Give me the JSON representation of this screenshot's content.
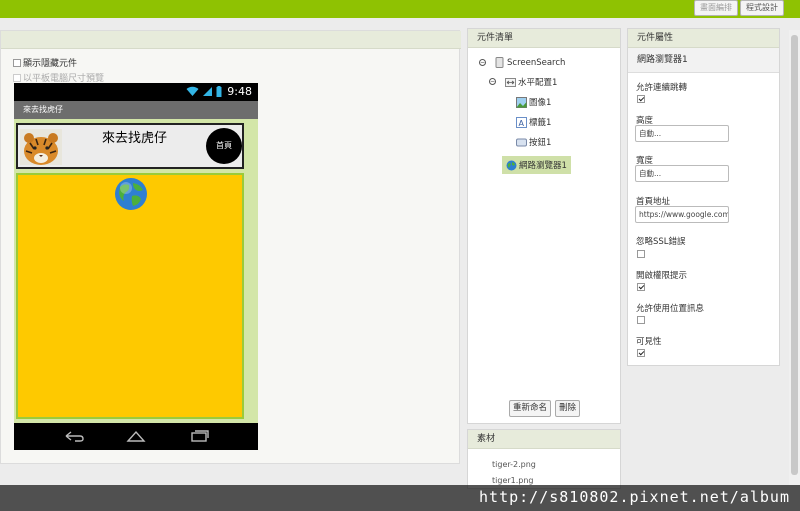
{
  "toolbar": {
    "designer_label": "畫面編排",
    "blocks_label": "程式設計"
  },
  "viewer": {
    "show_hidden_label": "顯示隱藏元件",
    "tablet_preview_label": "以平板電腦尺寸預覽",
    "phone": {
      "time": "9:48",
      "screen_title": "來去找虎仔",
      "label_text": "來去找虎仔",
      "home_button": "首頁"
    }
  },
  "components": {
    "title": "元件清單",
    "tree": [
      {
        "label": "ScreenSearch",
        "icon": "screen-icon"
      },
      {
        "label": "水平配置1",
        "icon": "horizontal-arrangement-icon"
      },
      {
        "label": "圖像1",
        "icon": "image-icon"
      },
      {
        "label": "標籤1",
        "icon": "label-icon"
      },
      {
        "label": "按鈕1",
        "icon": "button-icon"
      },
      {
        "label": "網路瀏覽器1",
        "icon": "webviewer-icon"
      }
    ],
    "rename_button": "重新命名",
    "delete_button": "刪除"
  },
  "media": {
    "title": "素材",
    "items": [
      "tiger-2.png",
      "tiger1.png"
    ]
  },
  "properties": {
    "title": "元件屬性",
    "component": "網路瀏覽器1",
    "allow_nav_label": "允許連續跳轉",
    "height_label": "高度",
    "height_value": "自動...",
    "width_label": "寬度",
    "width_value": "自動...",
    "homeurl_label": "首頁地址",
    "homeurl_value": "https://www.google.com/m",
    "ignore_ssl_label": "忽略SSL錯誤",
    "prompt_label": "開啟權限提示",
    "location_label": "允許使用位置訊息",
    "visible_label": "可見性"
  },
  "watermark": "http://s810802.pixnet.net/album",
  "colors": {
    "topbar": "#8fc202",
    "panel_header": "#e7ebdb",
    "webviewer_bg": "#fec900",
    "selected": "#cfe0a8"
  }
}
